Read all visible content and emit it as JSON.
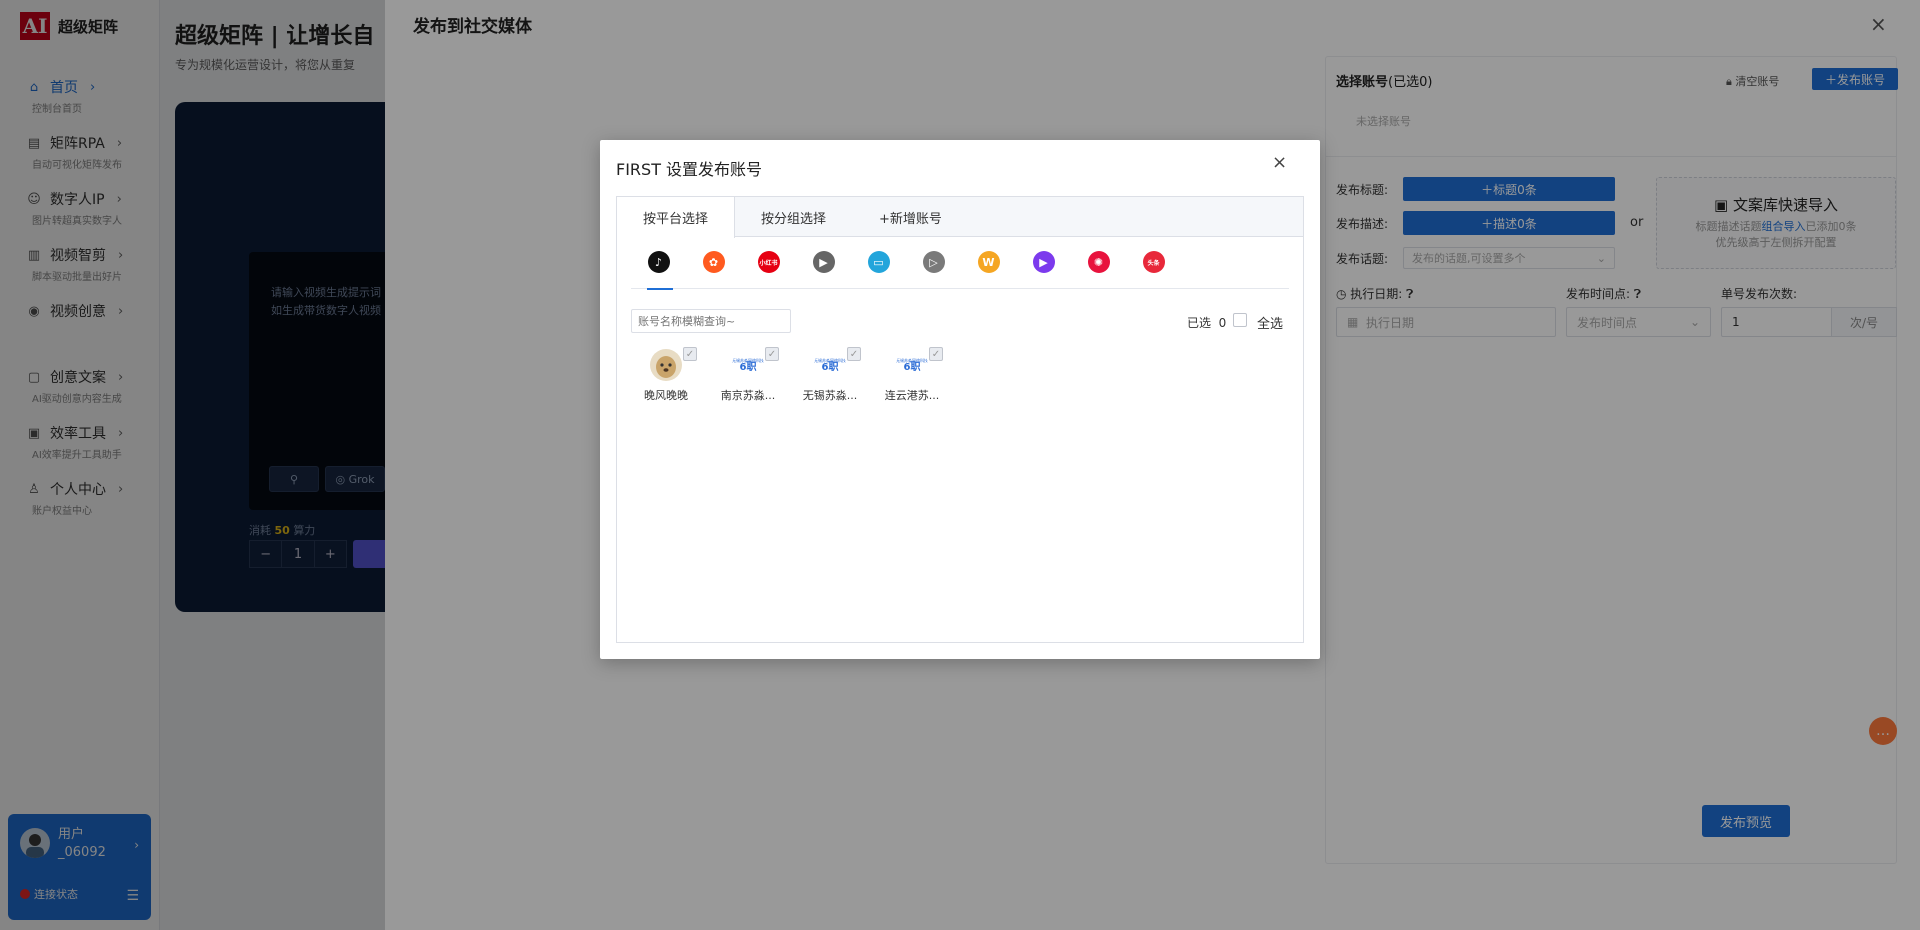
{
  "app": {
    "logo_mark": "AI",
    "logo_text": "超级矩阵"
  },
  "sidebar": {
    "items": [
      {
        "label": "首页",
        "sub": "控制台首页",
        "icon": "home-icon",
        "active": true
      },
      {
        "label": "矩阵RPA",
        "sub": "自动可视化矩阵发布",
        "icon": "rpa-icon"
      },
      {
        "label": "数字人IP",
        "sub": "图片转超真实数字人",
        "icon": "robot-icon"
      },
      {
        "label": "视频智剪",
        "sub": "脚本驱动批量出好片",
        "icon": "clip-icon"
      },
      {
        "label": "视频创意",
        "sub": "",
        "icon": "camera-icon"
      },
      {
        "label": "创意文案",
        "sub": "AI驱动创意内容生成",
        "icon": "chat-icon"
      },
      {
        "label": "效率工具",
        "sub": "AI效率提升工具助手",
        "icon": "toolbox-icon"
      },
      {
        "label": "个人中心",
        "sub": "账户权益中心",
        "icon": "user-icon"
      }
    ],
    "user": {
      "name_line1": "用户",
      "name_line2": "_06092",
      "status": "连接状态"
    }
  },
  "page": {
    "title": "超级矩阵 | 让增长自",
    "subtitle": "专为规模化运营设计，将您从重复",
    "hero_placeholder_1": "请输入视频生成提示词",
    "hero_placeholder_2": "如生成带货数字人视频",
    "hero_btn_model": "Grok",
    "hero_cost_prefix": "消耗",
    "hero_cost_value": "50",
    "hero_cost_suffix": "算力",
    "hero_qty": "1",
    "hero_minus": "−",
    "hero_plus": "+"
  },
  "drawer": {
    "title": "发布到社交媒体",
    "close": "×",
    "accounts_title": "选择账号",
    "accounts_count": "(已选0)",
    "clear_label": "清空账号",
    "publish_account_label": "＋发布账号",
    "empty_accounts": "未选择账号",
    "title_label": "发布标题:",
    "title_btn": "＋标题0条",
    "desc_label": "发布描述:",
    "desc_btn": "＋描述0条",
    "or": "or",
    "topic_label": "发布话题:",
    "topic_placeholder": "发布的话题,可设置多个",
    "import_title": "文案库快速导入",
    "import_desc_1a": "标题描述话题",
    "import_desc_1b": "组合导入",
    "import_desc_1c": "已添加0条",
    "import_desc_2": "优先级高于左侧拆开配置",
    "date_label": "执行日期:",
    "time_label": "发布时间点:",
    "count_label": "单号发布次数:",
    "date_placeholder": "执行日期",
    "time_placeholder": "发布时间点",
    "count_value": "1",
    "count_unit": "次/号",
    "preview_btn": "发布预览"
  },
  "modal": {
    "title": "FIRST 设置发布账号",
    "close": "×",
    "tabs": [
      "按平台选择",
      "按分组选择",
      "+新增账号"
    ],
    "platforms": [
      {
        "name": "douyin",
        "color": "#111111",
        "glyph": "♪"
      },
      {
        "name": "kuaishou",
        "color": "#ff5a1f",
        "glyph": "✿"
      },
      {
        "name": "xiaohongshu",
        "color": "#e60012",
        "glyph": "小红书"
      },
      {
        "name": "shipinhao",
        "color": "#666666",
        "glyph": "▶"
      },
      {
        "name": "bilibili",
        "color": "#23a5db",
        "glyph": "▭"
      },
      {
        "name": "xigua",
        "color": "#7a7a7a",
        "glyph": "▷"
      },
      {
        "name": "weibo",
        "color": "#f5a623",
        "glyph": "W"
      },
      {
        "name": "haokan",
        "color": "#7c3aed",
        "glyph": "▶"
      },
      {
        "name": "kuaishou-lite",
        "color": "#e8123d",
        "glyph": "✺"
      },
      {
        "name": "toutiao",
        "color": "#e8283a",
        "glyph": "头条"
      }
    ],
    "search_placeholder": "账号名称模糊查询~",
    "selected_label": "已选",
    "selected_count": "0",
    "select_all": "全选",
    "accounts": [
      {
        "name": "晚风晚晚",
        "avatar": "dog"
      },
      {
        "name": "南京苏淼...",
        "avatar": "logo"
      },
      {
        "name": "无锡苏淼...",
        "avatar": "logo"
      },
      {
        "name": "连云港苏...",
        "avatar": "logo"
      }
    ],
    "logo_text_small": "无锡苏淼网络科技",
    "logo_text_big": "6职"
  }
}
